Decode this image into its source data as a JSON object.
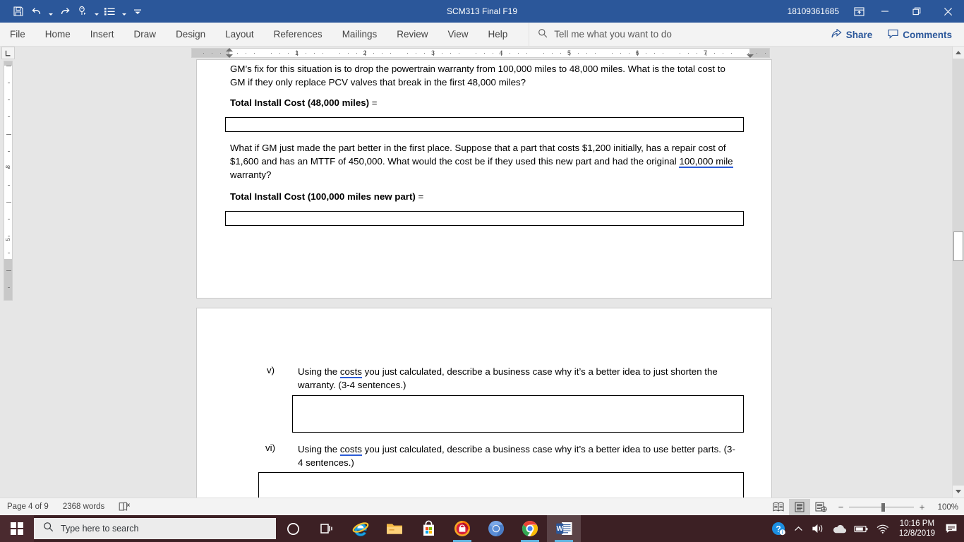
{
  "window": {
    "title": "SCM313 Final F19",
    "account": "18109361685",
    "quick_access": [
      {
        "name": "save",
        "label": "Save"
      },
      {
        "name": "undo",
        "label": "Undo"
      },
      {
        "name": "redo",
        "label": "Redo"
      },
      {
        "name": "touch-mouse-mode",
        "label": "Touch/Mouse Mode"
      },
      {
        "name": "bullets",
        "label": "Bullets"
      },
      {
        "name": "customize-quick-access-toolbar",
        "label": "Customize Quick Access Toolbar"
      }
    ],
    "controls": {
      "ribbon_display": "Ribbon Display Options",
      "minimize": "Minimize",
      "restore": "Restore Down",
      "close": "Close"
    }
  },
  "ribbon": {
    "tabs": [
      {
        "label": "File"
      },
      {
        "label": "Home"
      },
      {
        "label": "Insert"
      },
      {
        "label": "Draw"
      },
      {
        "label": "Design"
      },
      {
        "label": "Layout"
      },
      {
        "label": "References"
      },
      {
        "label": "Mailings"
      },
      {
        "label": "Review"
      },
      {
        "label": "View"
      },
      {
        "label": "Help"
      }
    ],
    "tell_me": "Tell me what you want to do",
    "share_label": "Share",
    "comments_label": "Comments"
  },
  "ruler": {
    "numbers": [
      "1",
      "2",
      "3",
      "4",
      "5",
      "6",
      "7"
    ],
    "vertical_numbers": [
      "8",
      "5"
    ]
  },
  "document": {
    "page_a": {
      "para1": "GM’s fix for this situation is to drop the powertrain warranty from 100,000 miles to 48,000 miles. What is the total cost to GM if they only replace PCV valves that break in the first 48,000 miles?",
      "label1": "Total Install Cost (48,000 miles)",
      "label1_eq": " =",
      "para2_a": "What if GM just made the part better in the first place. Suppose that a part that costs $1,200 initially, has a repair cost of $1,600 and has an MTTF of 450,000. What would the cost be if they used this new part and had the original ",
      "para2_underlined": "100,000 mile",
      "para2_b": " warranty?",
      "label2": "Total Install Cost (100,000 miles new part)",
      "label2_eq": " ="
    },
    "page_b": {
      "item_v_num": "v)",
      "item_v_a": "Using the ",
      "item_v_underlined": "costs",
      "item_v_b": " you just calculated, describe a business case why it’s a better idea to just shorten the warranty. (3-4 sentences.)",
      "item_vi_num": "vi)",
      "item_vi_a": "Using the ",
      "item_vi_underlined": "costs",
      "item_vi_b": " you just calculated, describe a business case why it’s a better idea to use better parts. (3-4 sentences.)"
    }
  },
  "status_bar": {
    "page": "Page 4 of 9",
    "words": "2368 words",
    "proofing": "Proofing errors",
    "views": [
      {
        "name": "read-mode",
        "label": "Read Mode"
      },
      {
        "name": "print-layout",
        "label": "Print Layout",
        "active": true
      },
      {
        "name": "web-layout",
        "label": "Web Layout"
      }
    ],
    "zoom_out": "−",
    "zoom_in": "+",
    "zoom_level": "100%"
  },
  "taskbar": {
    "start": "Start",
    "search_placeholder": "Type here to search",
    "apps": [
      {
        "name": "cortana-icon",
        "label": "Cortana"
      },
      {
        "name": "task-view-icon",
        "label": "Task View"
      },
      {
        "name": "internet-explorer-icon",
        "label": "Internet Explorer"
      },
      {
        "name": "file-explorer-icon",
        "label": "File Explorer"
      },
      {
        "name": "microsoft-store-icon",
        "label": "Microsoft Store"
      },
      {
        "name": "secure-browser-icon",
        "label": "Avast Secure Browser"
      },
      {
        "name": "chromium-icon",
        "label": "Chromium"
      },
      {
        "name": "google-chrome-icon",
        "label": "Google Chrome"
      },
      {
        "name": "word-icon",
        "label": "Microsoft Word"
      }
    ],
    "tray": {
      "help": "Get Help",
      "show_hidden": "Show hidden icons",
      "volume": "Volume",
      "onedrive": "OneDrive",
      "battery": "Battery",
      "network": "Network",
      "time": "10:16 PM",
      "date": "12/8/2019",
      "notifications": "Notifications"
    }
  },
  "colors": {
    "title_blue": "#2b579a",
    "taskbar": "#3c2024",
    "accent_blue": "#2b579a",
    "spell_underline": "#2b5bd7"
  }
}
